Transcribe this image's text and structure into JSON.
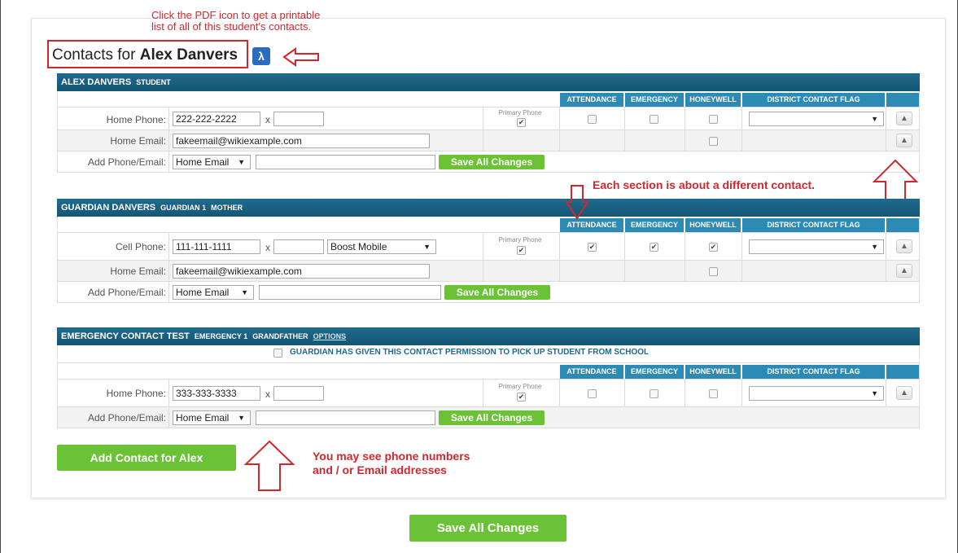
{
  "annotations": {
    "pdf_hint_line1": "Click the PDF icon to get a printable",
    "pdf_hint_line2": "list of all of this student's contacts.",
    "sections_hint": "Each section is about a different contact.",
    "phone_hint_line1": "You may see phone numbers",
    "phone_hint_line2": "and / or Email addresses"
  },
  "page": {
    "title_prefix": "Contacts for",
    "title_name": "Alex Danvers",
    "add_contact_label": "Add Contact for Alex",
    "save_all_label": "Save All Changes"
  },
  "columns": {
    "attendance": "ATTENDANCE",
    "emergency": "EMERGENCY",
    "honeywell": "HONEYWELL",
    "district_flag": "DISTRICT CONTACT FLAG"
  },
  "common": {
    "primary_phone": "Primary Phone",
    "add_label": "Add Phone/Email:",
    "add_type": "Home Email",
    "save_label": "Save All Changes",
    "x": "x",
    "home_phone": "Home Phone:",
    "home_email": "Home Email:",
    "cell_phone": "Cell Phone:"
  },
  "sections": [
    {
      "name": "ALEX DANVERS",
      "role": "STUDENT",
      "phone": "222-222-2222",
      "email": "fakeemail@wikiexample.com",
      "attendance": false,
      "emergency": false,
      "honeywell": false
    },
    {
      "name": "GUARDIAN DANVERS",
      "role": "GUARDIAN 1",
      "relation": "MOTHER",
      "phone": "111-111-1111",
      "carrier": "Boost Mobile",
      "email": "fakeemail@wikiexample.com",
      "attendance": true,
      "emergency": true,
      "honeywell": true
    },
    {
      "name": "EMERGENCY CONTACT TEST",
      "role": "EMERGENCY 1",
      "relation": "GRANDFATHER",
      "options": "OPTIONS",
      "permission": "GUARDIAN HAS GIVEN THIS CONTACT PERMISSION TO PICK UP STUDENT FROM SCHOOL",
      "phone": "333-333-3333",
      "attendance": false,
      "emergency": false,
      "honeywell": false
    }
  ],
  "colors": {
    "header_bg": "#155674",
    "col_header_bg": "#2c8bb5",
    "button_green": "#6cc236",
    "annotation_red": "#d0282e"
  }
}
